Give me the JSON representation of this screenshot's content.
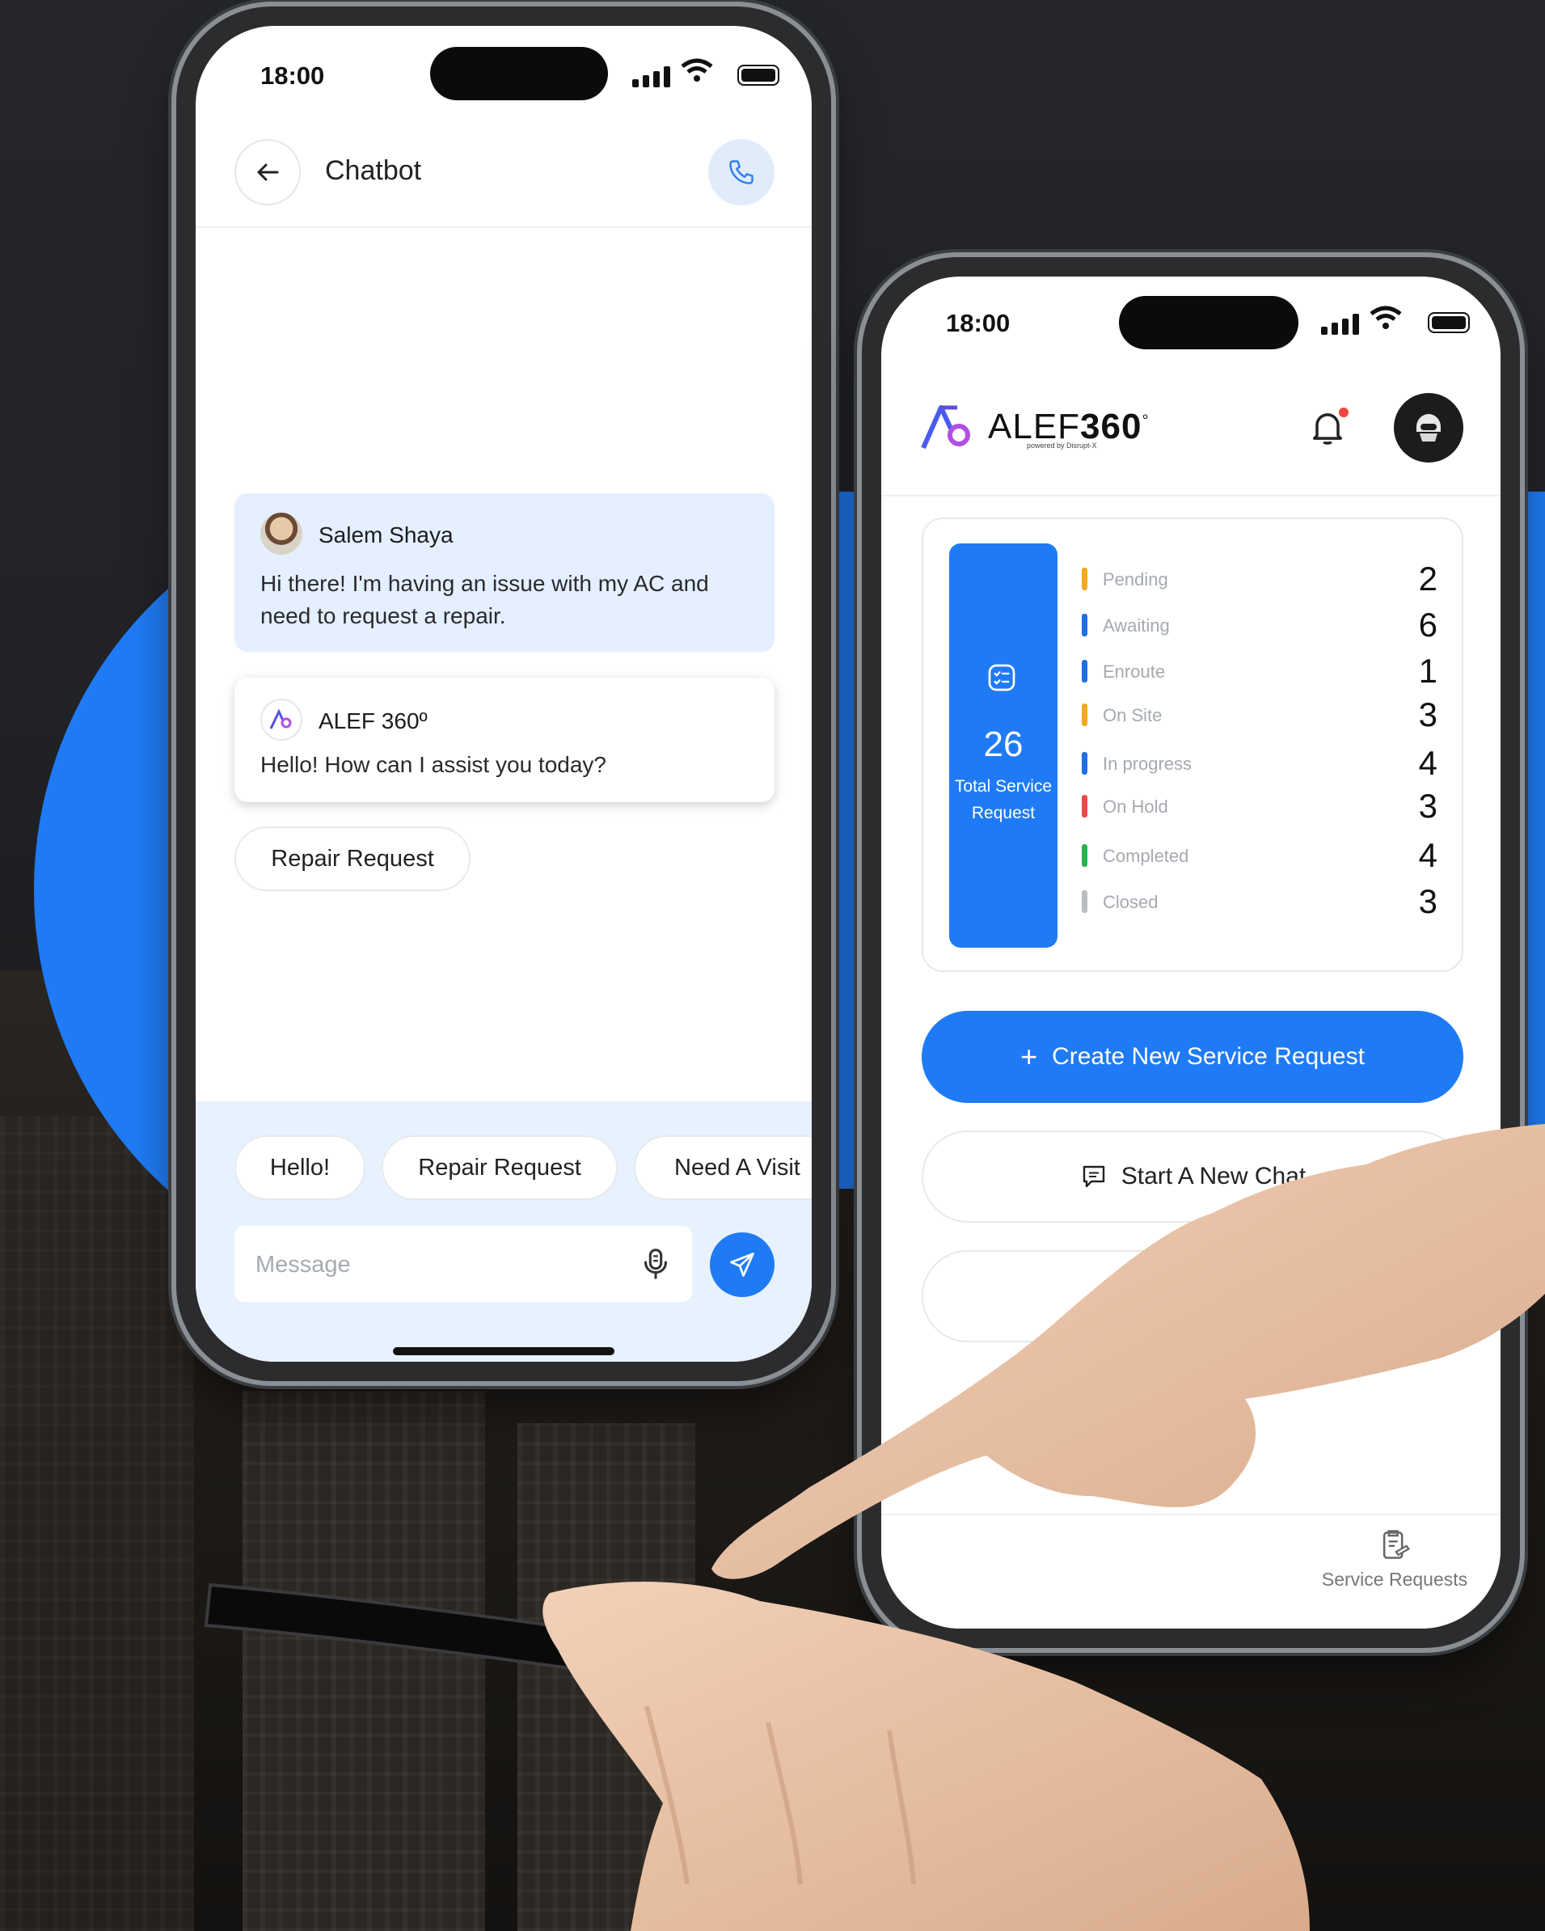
{
  "chatbot_screen": {
    "status_time": "18:00",
    "header": {
      "title": "Chatbot",
      "back_icon": "arrow-left-icon",
      "call_icon": "phone-icon"
    },
    "messages": [
      {
        "sender": "Salem Shaya",
        "text": "Hi there! I'm having an issue with my AC and need to request a repair."
      },
      {
        "sender": "ALEF 360º",
        "text": "Hello! How can I assist you today?"
      }
    ],
    "suggestion": "Repair Request",
    "quick_replies": [
      "Hello!",
      "Repair Request",
      "Need A Visit"
    ],
    "input": {
      "placeholder": "Message",
      "value": ""
    }
  },
  "dashboard_screen": {
    "status_time": "18:00",
    "brand": {
      "name_light": "ALEF",
      "name_bold": "360",
      "degree": "°",
      "powered_by": "powered by Disrupt-X"
    },
    "summary": {
      "total": "26",
      "total_label": "Total Service Request"
    },
    "statuses": [
      {
        "label": "Pending",
        "value": "2",
        "color": "#f5a623"
      },
      {
        "label": "Awaiting",
        "value": "6",
        "color": "#1f6fe5"
      },
      {
        "label": "Enroute",
        "value": "1",
        "color": "#1f6fe5"
      },
      {
        "label": "On Site",
        "value": "3",
        "color": "#f5a623"
      },
      {
        "label": "In progress",
        "value": "4",
        "color": "#1f6fe5"
      },
      {
        "label": "On Hold",
        "value": "3",
        "color": "#ec4a4a"
      },
      {
        "label": "Completed",
        "value": "4",
        "color": "#2bb24c"
      },
      {
        "label": "Closed",
        "value": "3",
        "color": "#b8bcc2"
      }
    ],
    "create_button": {
      "icon": "+",
      "label": "Create New Service Request"
    },
    "chat_button": {
      "label": "Start A New Chat"
    },
    "tabbar": {
      "service_requests": "Service Requests"
    }
  },
  "colors": {
    "accent": "#1f7bf5",
    "background": "#1f2024"
  }
}
